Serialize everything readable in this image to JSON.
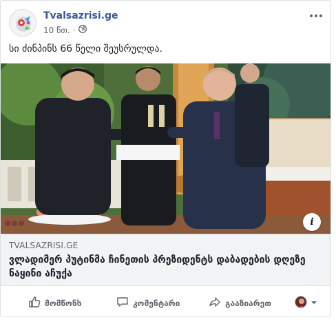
{
  "post": {
    "page_name": "Tvalsazrisi.ge",
    "time": "10 წთ.",
    "separator": "·",
    "privacy_icon": "globe-icon",
    "text": "სი ძინპინს 66 წელი შეუსრულდა."
  },
  "link_preview": {
    "domain": "TVALSAZRISI.GE",
    "headline": "ვლადიმერ პუტინმა ჩინეთის პრეზიდენტს დაბადების დღეზე ნაყინი აჩუქა"
  },
  "actions": {
    "like": "მომწონს",
    "comment": "კომენტარი",
    "share": "გააზიარეთ"
  },
  "colors": {
    "page_name": "#385898",
    "secondary_text": "#606770",
    "link_box_bg": "#f2f3f5"
  }
}
